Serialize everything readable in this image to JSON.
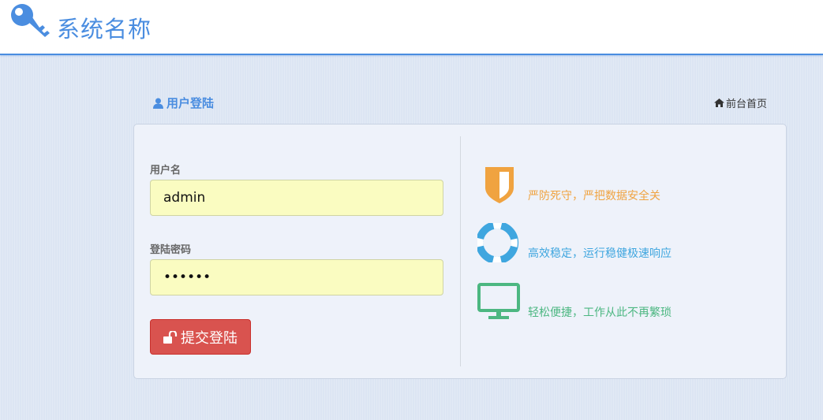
{
  "header": {
    "title": "系统名称",
    "logo_icon": "key-icon"
  },
  "login": {
    "heading": "用户登陆",
    "heading_icon": "user-icon",
    "home_link": "前台首页",
    "home_icon": "home-icon",
    "username_label": "用户名",
    "username_value": "admin",
    "password_label": "登陆密码",
    "password_value": "••••••",
    "submit_label": "提交登陆",
    "submit_icon": "unlock-icon"
  },
  "features": [
    {
      "icon": "shield-icon",
      "text": "严防死守，严把数据安全关",
      "color": "#f0a340"
    },
    {
      "icon": "lifebuoy-icon",
      "text": "高效稳定，运行稳健极速响应",
      "color": "#3fa6df"
    },
    {
      "icon": "monitor-icon",
      "text": "轻松便捷，工作从此不再繁琐",
      "color": "#4cb781"
    }
  ],
  "colors": {
    "brand": "#4a8de0",
    "danger": "#d9534f",
    "input_bg": "#fafcc1",
    "page_bg": "#dce5f3"
  }
}
